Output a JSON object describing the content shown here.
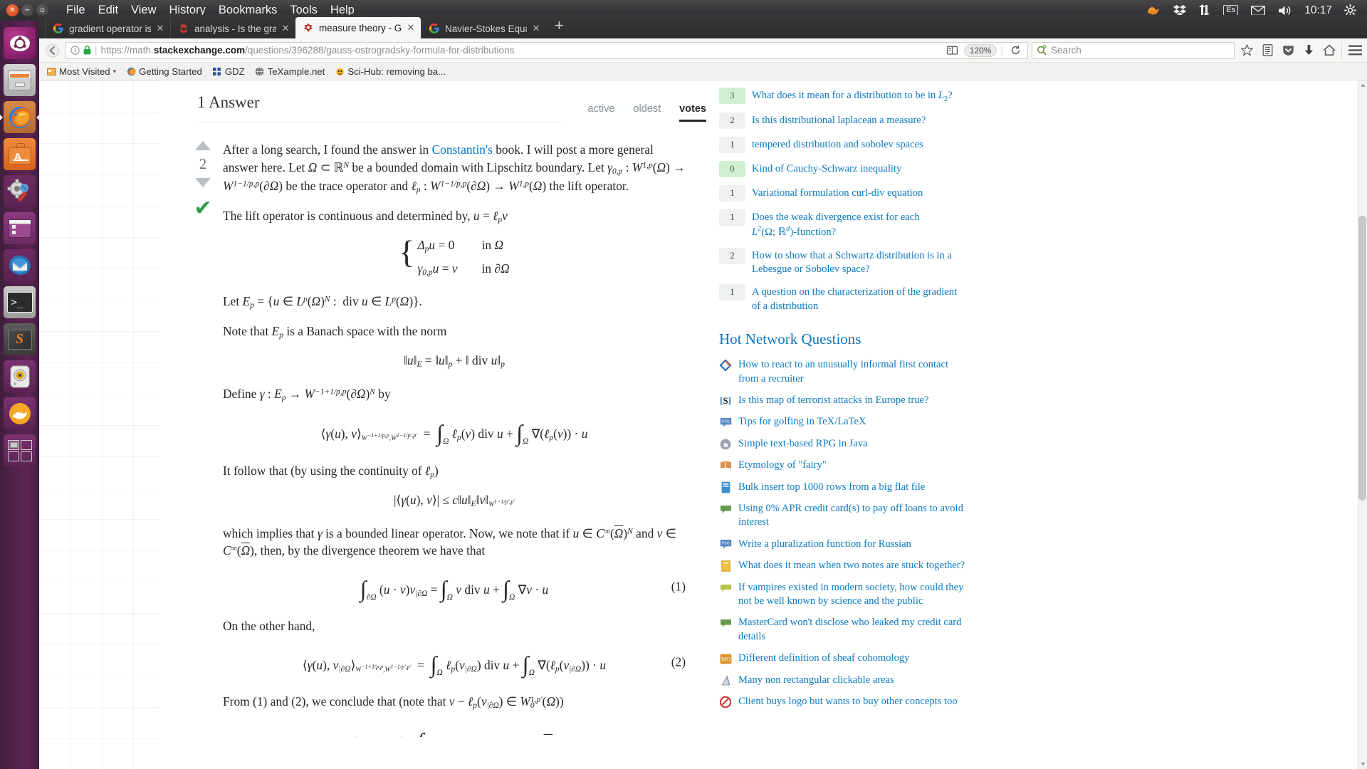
{
  "desktop": {
    "window_controls": [
      "close",
      "minimize",
      "maximize"
    ],
    "menus": [
      "File",
      "Edit",
      "View",
      "History",
      "Bookmarks",
      "Tools",
      "Help"
    ],
    "indicators": {
      "clock": "10:17",
      "keyboard_layout": "Es",
      "items": [
        "ubuntuone-icon",
        "dropbox-icon",
        "network-icon",
        "keyboard-layout-icon",
        "mail-icon",
        "volume-icon",
        "clock",
        "system-gear-icon"
      ]
    },
    "launcher": [
      {
        "name": "ubuntu-dash-icon",
        "label": "Dash home"
      },
      {
        "name": "files-icon",
        "label": "Files"
      },
      {
        "name": "firefox-icon",
        "label": "Firefox Web Browser",
        "active": true
      },
      {
        "name": "software-center-icon",
        "label": "Ubuntu Software Center"
      },
      {
        "name": "system-settings-icon",
        "label": "System Settings"
      },
      {
        "name": "screenshot-icon",
        "label": "Screenshot"
      },
      {
        "name": "thunderbird-icon",
        "label": "Thunderbird Mail"
      },
      {
        "name": "terminal-icon",
        "label": "Terminal"
      },
      {
        "name": "sublime-text-icon",
        "label": "Sublime Text"
      },
      {
        "name": "audacious-icon",
        "label": "Audacious"
      },
      {
        "name": "anaconda-icon",
        "label": "Anaconda Navigator"
      },
      {
        "name": "workspace-switcher-icon",
        "label": "Workspace Switcher"
      }
    ]
  },
  "browser": {
    "tabs": [
      {
        "title": "gradient operator is o",
        "favicon": "google-icon",
        "selected": false
      },
      {
        "title": "analysis - Is the gradie",
        "favicon": "stackexchange-icon",
        "selected": false
      },
      {
        "title": "measure theory - Gaus",
        "favicon": "mathse-icon",
        "selected": true
      },
      {
        "title": "Navier-Stokes Equatio",
        "favicon": "google-icon",
        "selected": false
      }
    ],
    "new_tab_label": "+",
    "url": {
      "scheme": "https://",
      "host_prefix": "math.",
      "host_bold": "stackexchange.com",
      "path": "/questions/396288/gauss-ostrogradsky-formula-for-distributions",
      "full": "https://math.stackexchange.com/questions/396288/gauss-ostrogradsky-formula-for-distributions"
    },
    "zoom_level": "120%",
    "search_placeholder": "Search",
    "toolbar_icons": [
      "back-icon",
      "page-info-icon",
      "lock-icon",
      "reader-mode-icon",
      "reload-icon",
      "search-engine-icon",
      "bookmark-star-icon",
      "reading-list-icon",
      "pocket-icon",
      "downloads-icon",
      "home-icon",
      "menu-icon"
    ],
    "bookmarks": [
      {
        "label": "Most Visited",
        "icon": "most-visited-icon",
        "has_caret": true
      },
      {
        "label": "Getting Started",
        "icon": "firefox-icon",
        "has_caret": false
      },
      {
        "label": "GDZ",
        "icon": "gdz-icon",
        "has_caret": false
      },
      {
        "label": "TeXample.net",
        "icon": "globe-icon",
        "has_caret": false
      },
      {
        "label": "Sci-Hub: removing ba...",
        "icon": "scihub-icon",
        "has_caret": false
      }
    ]
  },
  "answers": {
    "heading": "1 Answer",
    "tabs": [
      {
        "label": "active",
        "selected": false
      },
      {
        "label": "oldest",
        "selected": false
      },
      {
        "label": "votes",
        "selected": true
      }
    ],
    "vote_score": "2",
    "accepted_mark": "✔",
    "paragraphs": {
      "p1_before_link": "After a long search, I found the answer in ",
      "p1_link": "Constantin's",
      "p1_after_link": " book. I will post a more general answer here. Let",
      "p2": "The lift operator is continuous and determined by,",
      "p3_prefix": "Let",
      "p4_prefix": "Note that",
      "p4_suffix": "is a Banach space with the norm",
      "p5_prefix": "Define",
      "p5_suffix": "by",
      "p6": "It follow that (by using the continuity of",
      "p7_a": "which implies that",
      "p7_b": "is a bounded linear operator. Now, we note that if",
      "p7_c": "and",
      "p7_d": "then, by the divergence theorem we have that",
      "p8": "On the other hand,",
      "p9": "From (1) and (2), we conclude that (note that"
    },
    "equation_numbers": {
      "eq1": "(1)",
      "eq2": "(2)"
    }
  },
  "sidebar": {
    "linked": [
      {
        "votes": "3",
        "accepted": true,
        "title": "What does it mean for a distribution to be in L₂?"
      },
      {
        "votes": "2",
        "accepted": false,
        "title": "Is this distributional laplacean a measure?"
      },
      {
        "votes": "1",
        "accepted": false,
        "title": "tempered distribution and sobolev spaces"
      },
      {
        "votes": "0",
        "accepted": true,
        "title": "Kind of Cauchy-Schwarz inequality"
      },
      {
        "votes": "1",
        "accepted": false,
        "title": "Variational formulation curl-div equation"
      },
      {
        "votes": "1",
        "accepted": false,
        "title": "Does the weak divergence exist for each L²(Ω; ℝᵈ)-function?"
      },
      {
        "votes": "2",
        "accepted": false,
        "title": "How to show that a Schwartz distribution is in a Lebesgue or Sobolev space?"
      },
      {
        "votes": "1",
        "accepted": false,
        "title": "A question on the characterization of the gradient of a distribution"
      }
    ],
    "hot_title": "Hot Network Questions",
    "hot": [
      {
        "icon": "workplace-icon",
        "title": "How to react to an unusually informal first contact from a recruiter"
      },
      {
        "icon": "skeptics-icon",
        "title": "Is this map of terrorist attacks in Europe true?"
      },
      {
        "icon": "codegolf-icon",
        "title": "Tips for golfing in TeX/LaTeX"
      },
      {
        "icon": "stackoverflow-icon",
        "title": "Simple text-based RPG in Java"
      },
      {
        "icon": "english-icon",
        "title": "Etymology of \"fairy\""
      },
      {
        "icon": "serverfault-icon",
        "title": "Bulk insert top 1000 rows from a big flat file"
      },
      {
        "icon": "money-icon",
        "title": "Using 0% APR credit card(s) to pay off loans to avoid interest"
      },
      {
        "icon": "codegolf-icon",
        "title": "Write a pluralization function for Russian"
      },
      {
        "icon": "interpersonal-icon",
        "title": "What does it mean when two notes are stuck together?"
      },
      {
        "icon": "worldbuilding-icon",
        "title": "If vampires existed in modern society, how could they not be well known by science and the public"
      },
      {
        "icon": "money-icon",
        "title": "MasterCard won't disclose who leaked my credit card details"
      },
      {
        "icon": "mathoverflow-icon",
        "title": "Different definition of sheaf cohomology"
      },
      {
        "icon": "graphicdesign-icon",
        "title": "Many non rectangular clickable areas"
      },
      {
        "icon": "graphicdesign2-icon",
        "title": "Client buys logo but wants to buy other concepts too"
      }
    ]
  },
  "colors": {
    "link": "#0c7ac1",
    "accepted_green": "#2e9e47",
    "accepted_bg": "#cfefd0",
    "vote_bg": "#eff0f1",
    "launcher_purple": "#572450",
    "panel_dark": "#3b383c"
  }
}
